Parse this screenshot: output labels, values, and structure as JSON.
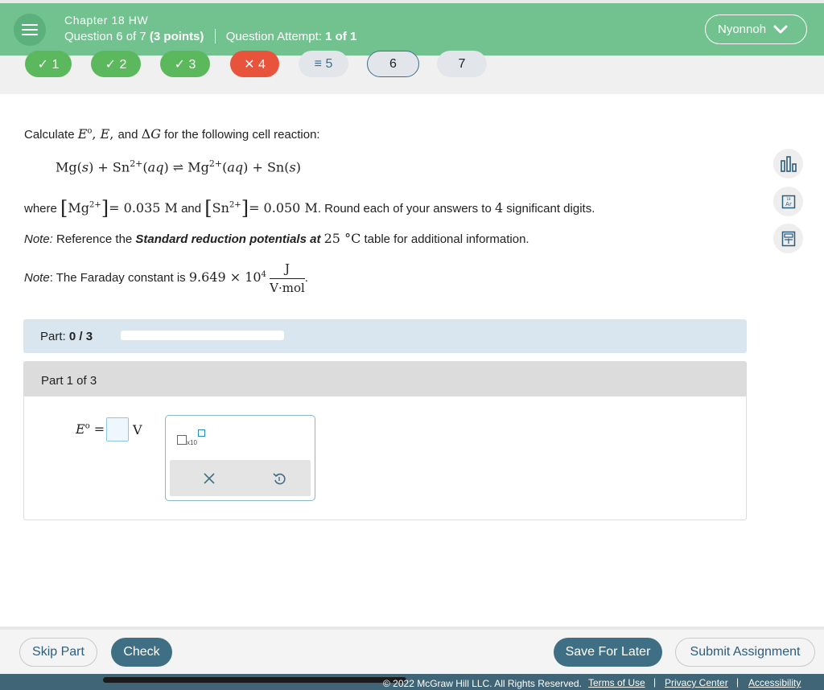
{
  "header": {
    "chapter": "Chapter 18 HW",
    "question_prefix": "Question 6 of 7",
    "points": "(3 points)",
    "attempt_label": "Question Attempt:",
    "attempt_value": "1 of 1",
    "user": "Nyonnoh",
    "color": "#71c28f"
  },
  "question_nav": [
    {
      "label": "✓ 1",
      "status": "correct"
    },
    {
      "label": "✓ 2",
      "status": "correct"
    },
    {
      "label": "✓ 3",
      "status": "correct"
    },
    {
      "label": "✕ 4",
      "status": "incorrect"
    },
    {
      "label": "≡ 5",
      "status": "partial"
    },
    {
      "label": "6",
      "status": "current"
    },
    {
      "label": "7",
      "status": "unanswered"
    }
  ],
  "question": {
    "intro_prefix": "Calculate ",
    "intro_suffix": " for the following cell reaction:",
    "where": "where",
    "and": "and",
    "mg_conc": "= 0.035 M",
    "sn_conc": "= 0.050 M",
    "round_prefix": ". Round each of your answers to ",
    "sig_digits": "4",
    "round_suffix": " significant digits.",
    "note1_label": "Note:",
    "note1_text": " Reference the ",
    "note1_bold": "Standard reduction potentials at",
    "note1_temp": "25 °C",
    "note1_tail": " table for additional information.",
    "note2_label": "Note",
    "note2_text": ": The Faraday constant is ",
    "faraday_value": "9.649 × 10",
    "faraday_exp": "4",
    "faraday_unit_num": "J",
    "faraday_unit_den": "V·mol"
  },
  "tools": [
    "bar-chart-icon",
    "periodic-table-icon",
    "calculator-icon"
  ],
  "part": {
    "label": "Part:",
    "score": "0 / 3",
    "progress_fraction": 0,
    "header": "Part 1 of 3",
    "answer_label": "E° =",
    "unit": "V",
    "keypad_x10": "x10"
  },
  "footer": {
    "skip": "Skip Part",
    "check": "Check",
    "save": "Save For Later",
    "submit": "Submit Assignment",
    "copyright": "© 2022 McGraw Hill LLC. All Rights Reserved.",
    "links": [
      "Terms of Use",
      "Privacy Center",
      "Accessibility"
    ]
  }
}
